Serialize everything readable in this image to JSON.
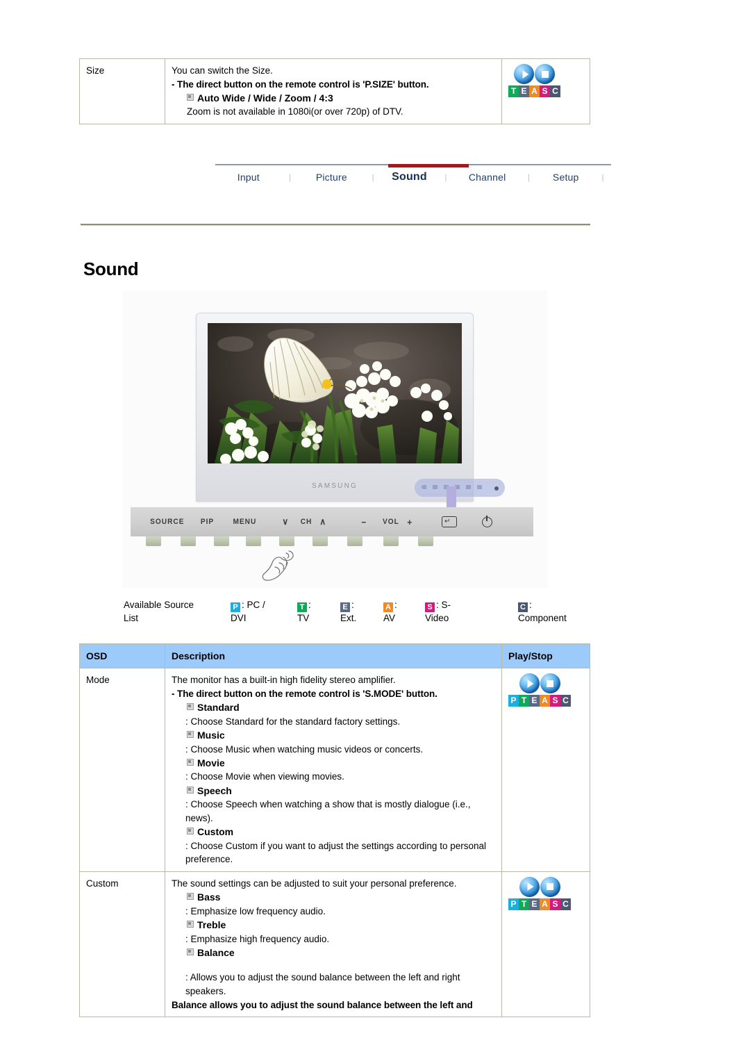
{
  "size_section": {
    "osd_label": "Size",
    "lines": [
      {
        "type": "plain",
        "text": "You can switch the Size."
      },
      {
        "type": "bold",
        "text": "- The direct button on the remote control is 'P.SIZE' button."
      },
      {
        "type": "bullet",
        "text": "Auto Wide / Wide / Zoom / 4:3"
      },
      {
        "type": "plain_indent",
        "text": "Zoom is not available in 1080i(or over 720p) of DTV."
      }
    ],
    "icon": {
      "name": "play-stop-teasc-icon",
      "letters": [
        "T",
        "E",
        "A",
        "S",
        "C"
      ]
    }
  },
  "nav": {
    "items": [
      {
        "label": "Input",
        "active": false
      },
      {
        "label": "Picture",
        "active": false
      },
      {
        "label": "Sound",
        "active": true
      },
      {
        "label": "Channel",
        "active": false
      },
      {
        "label": "Setup",
        "active": false
      }
    ],
    "separator": "|",
    "active_color": "#9a1c22",
    "link_color": "#1c3f73"
  },
  "heading": "Sound",
  "figure": {
    "brand": "SAMSUNG",
    "controls": [
      "SOURCE",
      "PIP",
      "MENU",
      "CH",
      "VOL"
    ],
    "control_labels": {
      "source": "SOURCE",
      "pip": "PIP",
      "menu": "MENU",
      "ch_down": "∨",
      "ch": "CH",
      "ch_up": "∧",
      "vol_minus": "−",
      "vol": "VOL",
      "vol_plus": "+",
      "enter": "↵",
      "power": "⏻"
    }
  },
  "source_list": {
    "title_line1": "Available Source",
    "title_line2": "List",
    "entries": [
      {
        "letter": "P",
        "color": "#19b0e0",
        "sep": ": PC /",
        "value": "DVI"
      },
      {
        "letter": "T",
        "color": "#0fa95a",
        "sep": ":",
        "value": "TV"
      },
      {
        "letter": "E",
        "color": "#5a6a84",
        "sep": ":",
        "value": "Ext."
      },
      {
        "letter": "A",
        "color": "#f08a24",
        "sep": ":",
        "value": "AV"
      },
      {
        "letter": "S",
        "color": "#d6197e",
        "sep": ": S-",
        "value": "Video"
      },
      {
        "letter": "C",
        "color": "#4c5872",
        "sep": ":",
        "value": "Component"
      }
    ]
  },
  "osd_table": {
    "headers": {
      "osd": "OSD",
      "description": "Description",
      "play_stop": "Play/Stop"
    },
    "rows": [
      {
        "osd": "Mode",
        "lines": [
          {
            "type": "plain",
            "text": "The monitor has a built-in high fidelity stereo amplifier."
          },
          {
            "type": "bold",
            "text": "- The direct button on the remote control is 'S.MODE' button."
          },
          {
            "type": "bullet",
            "text": "Standard"
          },
          {
            "type": "desc",
            "text": ": Choose Standard for the standard factory settings."
          },
          {
            "type": "bullet",
            "text": "Music"
          },
          {
            "type": "desc",
            "text": ": Choose Music when watching music videos or concerts."
          },
          {
            "type": "bullet",
            "text": "Movie"
          },
          {
            "type": "desc",
            "text": ": Choose Movie when viewing movies."
          },
          {
            "type": "bullet",
            "text": "Speech"
          },
          {
            "type": "desc",
            "text": ": Choose Speech when watching a show that is mostly dialogue (i.e., news)."
          },
          {
            "type": "bullet",
            "text": "Custom"
          },
          {
            "type": "desc",
            "text": ": Choose Custom if you want to adjust the settings according to personal preference."
          }
        ],
        "icon": {
          "name": "play-stop-pteasc-icon",
          "letters": [
            "P",
            "T",
            "E",
            "A",
            "S",
            "C"
          ]
        }
      },
      {
        "osd": "Custom",
        "lines": [
          {
            "type": "plain",
            "text": "The sound settings can be adjusted to suit your personal preference."
          },
          {
            "type": "bullet",
            "text": "Bass"
          },
          {
            "type": "desc",
            "text": ": Emphasize low frequency audio."
          },
          {
            "type": "bullet",
            "text": "Treble"
          },
          {
            "type": "desc",
            "text": ": Emphasize high frequency audio."
          },
          {
            "type": "bullet",
            "text": "Balance"
          },
          {
            "type": "spacer",
            "text": ""
          },
          {
            "type": "desc",
            "text": ": Allows you to adjust the sound balance between the left and right speakers."
          },
          {
            "type": "bold",
            "text": "Balance allows you to adjust the sound balance between the left and"
          }
        ],
        "icon": {
          "name": "play-stop-pteasc-icon",
          "letters": [
            "P",
            "T",
            "E",
            "A",
            "S",
            "C"
          ]
        }
      }
    ]
  },
  "badge_colors": {
    "P": "#19b0e0",
    "T": "#0fa95a",
    "E": "#5a6a84",
    "A": "#f08a24",
    "S": "#d6197e",
    "C": "#4c5872"
  },
  "theme": {
    "table_header_bg": "#9ccafb",
    "table_border": "#b9b9a8",
    "accent_red": "#9a1c22"
  }
}
